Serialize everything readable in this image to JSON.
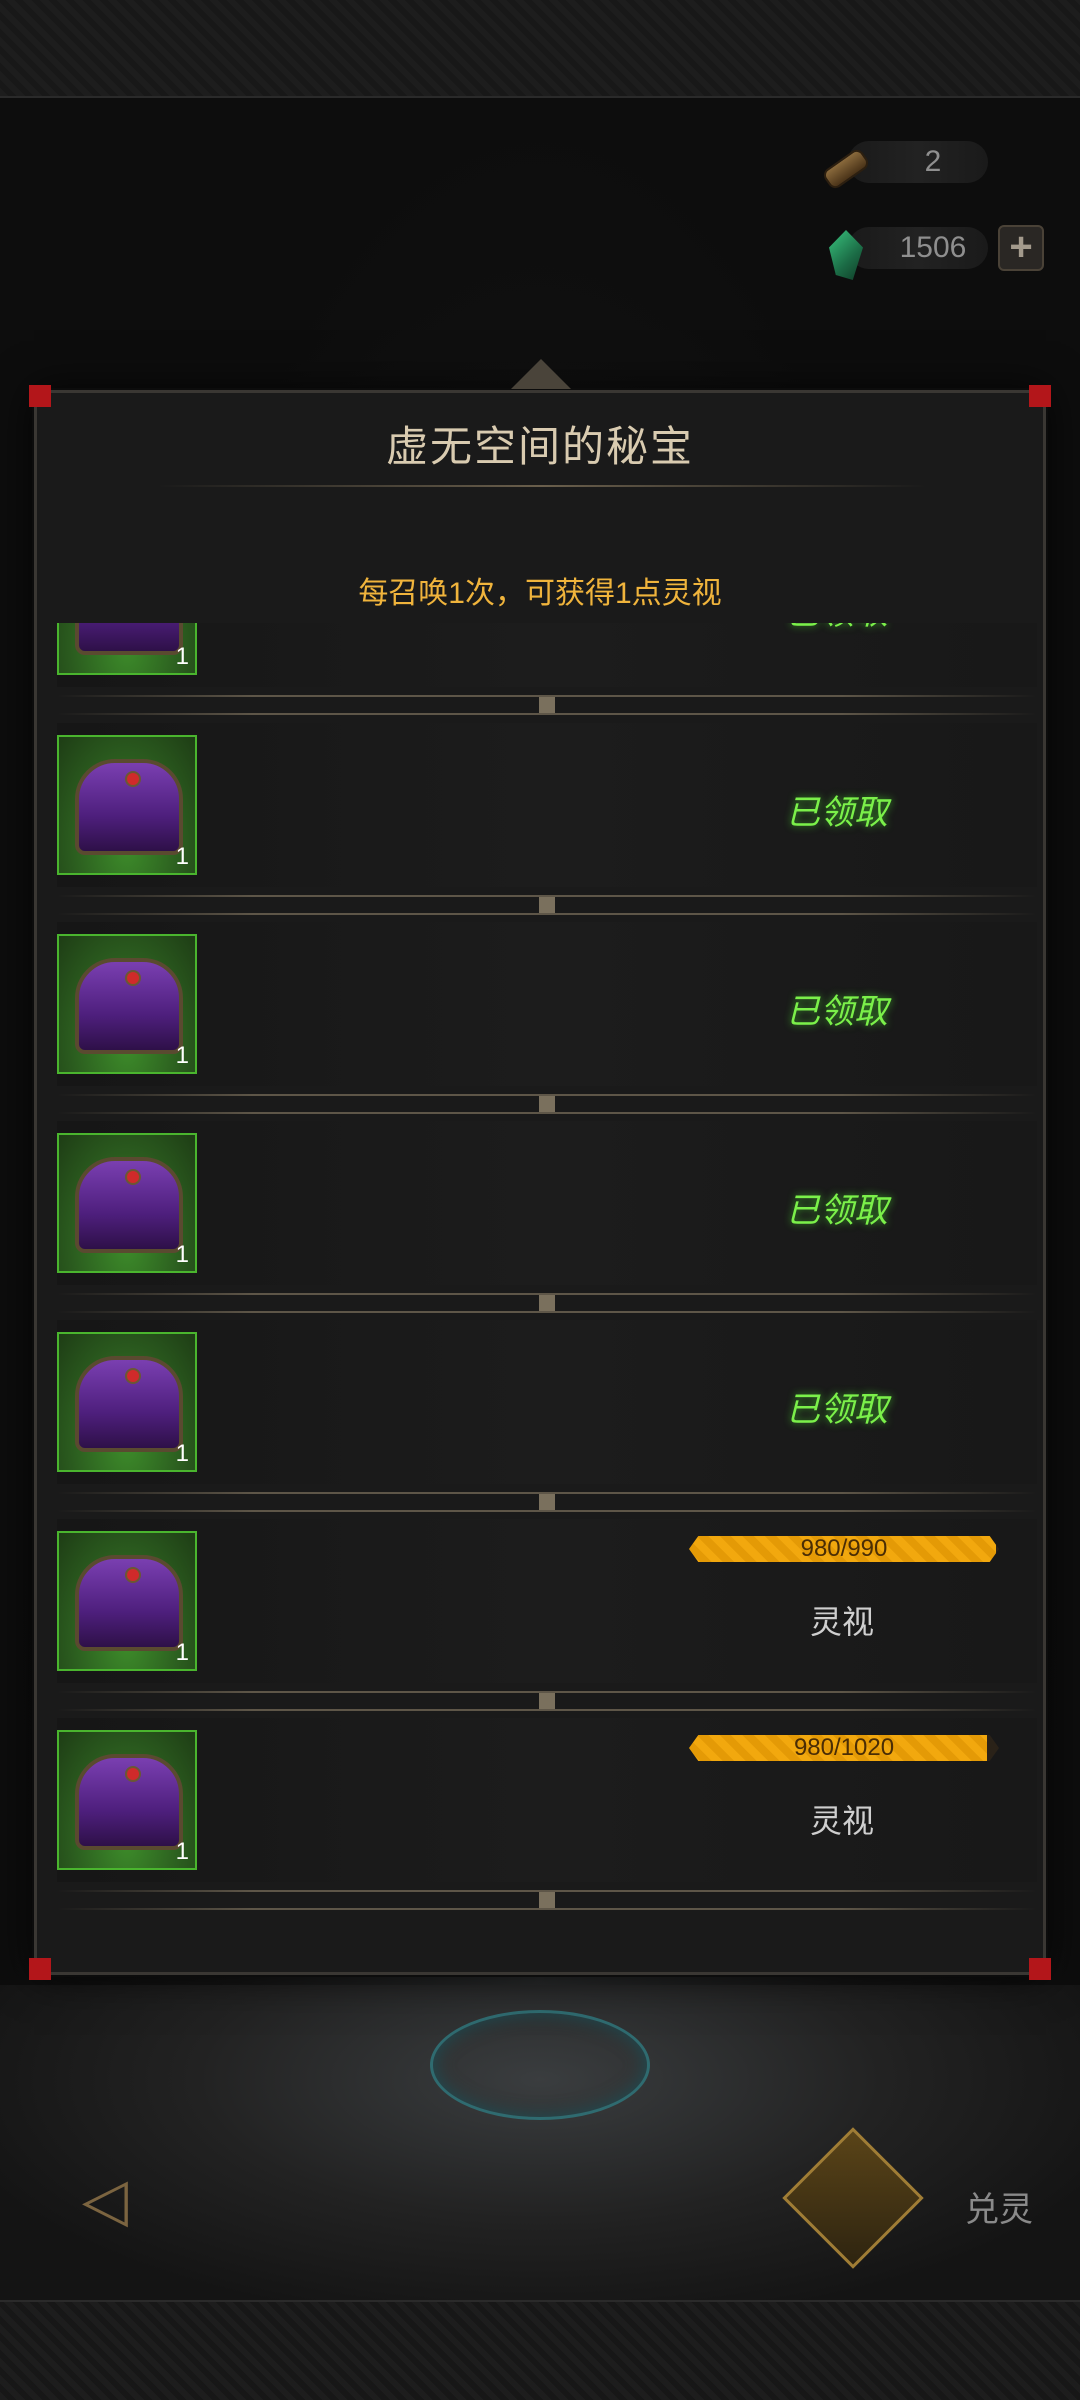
{
  "currency": {
    "scroll": {
      "icon": "scroll-icon",
      "value": "2"
    },
    "gem": {
      "icon": "gem-icon",
      "value": "1506",
      "add_icon": "plus-icon"
    }
  },
  "panel": {
    "title": "虚无空间的秘宝",
    "subtitle": "每召唤1次，可获得1点灵视"
  },
  "rewards": [
    {
      "count": "1",
      "status": "已领取"
    },
    {
      "count": "1",
      "status": "已领取"
    },
    {
      "count": "1",
      "status": "已领取"
    },
    {
      "count": "1",
      "status": "已领取"
    },
    {
      "count": "1",
      "status": "已领取"
    },
    {
      "count": "1",
      "progress_text": "980/990",
      "progress": 0.99,
      "label": "灵视"
    },
    {
      "count": "1",
      "progress_text": "980/1020",
      "progress": 0.96,
      "label": "灵视"
    }
  ],
  "bottom": {
    "back_icon": "back-arrow-icon",
    "summon_label": "兑灵"
  },
  "colors": {
    "claimed": "#7bf04a",
    "subtitle": "#f0b43c",
    "progress": "#f2a80e",
    "frame_corner": "#b3161a"
  }
}
